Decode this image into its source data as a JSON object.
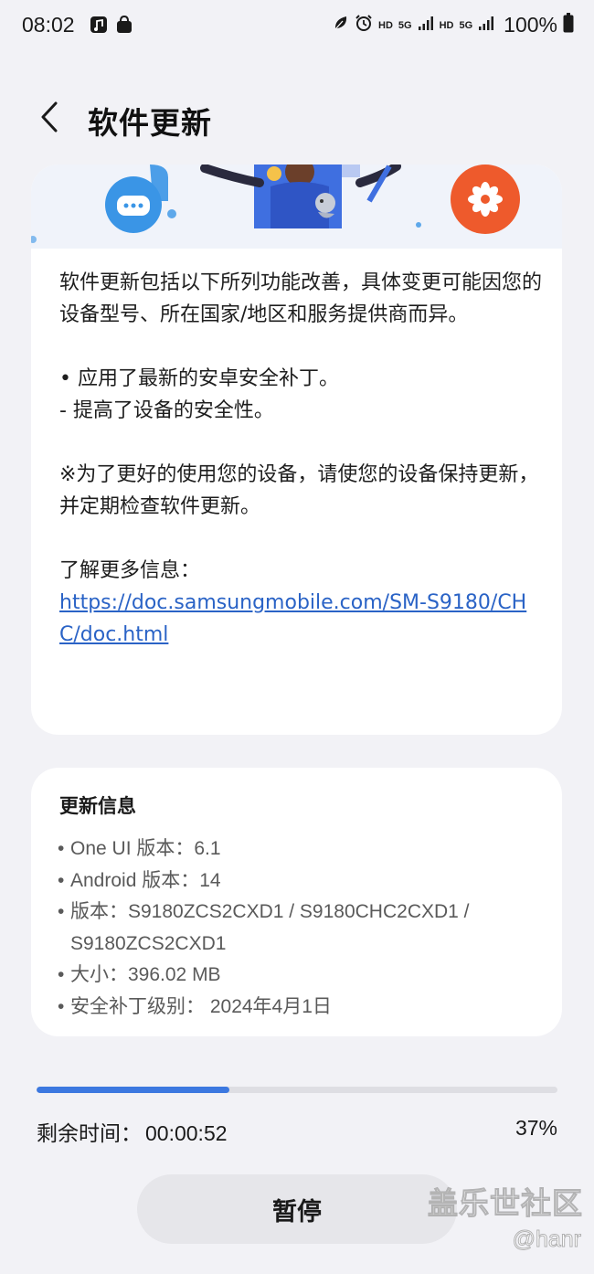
{
  "status_bar": {
    "time": "08:02",
    "network_hd_1": "HD",
    "network_5g_1": "5G",
    "network_hd_2": "HD",
    "network_5g_2": "5G",
    "battery": "100%"
  },
  "header": {
    "title": "软件更新"
  },
  "release_notes": {
    "intro": "软件更新包括以下所列功能改善，具体变更可能因您的设备型号、所在国家/地区和服务提供商而异。",
    "item_1": "• 应用了最新的安卓安全补丁。",
    "item_1_detail": " - 提高了设备的安全性。",
    "note": "※为了更好的使用您的设备，请使您的设备保持更新，并定期检查软件更新。",
    "more_info_label": "了解更多信息：",
    "more_info_link": "https://doc.samsungmobile.com/SM-S9180/CHC/doc.html"
  },
  "update_info": {
    "title": "更新信息",
    "items": [
      "One UI 版本：6.1",
      "Android 版本：14",
      "版本：S9180ZCS2CXD1 / S9180CHC2CXD1 / S9180ZCS2CXD1",
      "大小：396.02 MB",
      "安全补丁级别： 2024年4月1日"
    ]
  },
  "progress": {
    "fraction": 0.37,
    "remaining_label": "剩余时间：",
    "remaining_value": "00:00:52",
    "percent_text": "37%"
  },
  "actions": {
    "pause_label": "暂停"
  },
  "watermark": {
    "main": "盖乐世社区",
    "sub": "@hanr"
  },
  "colors": {
    "accent": "#3c78e0",
    "link": "#2a63c6",
    "background": "#f2f2f6",
    "chat_bubble": "#3a95e6",
    "flower_badge": "#ee5a2c"
  },
  "icons": {
    "back": "chevron-left-icon",
    "app_notification_1": "music-app-icon",
    "app_notification_2": "shopping-bag-icon",
    "leaf": "leaf-icon",
    "alarm": "alarm-icon",
    "signal": "signal-bars-icon",
    "battery": "battery-icon"
  }
}
